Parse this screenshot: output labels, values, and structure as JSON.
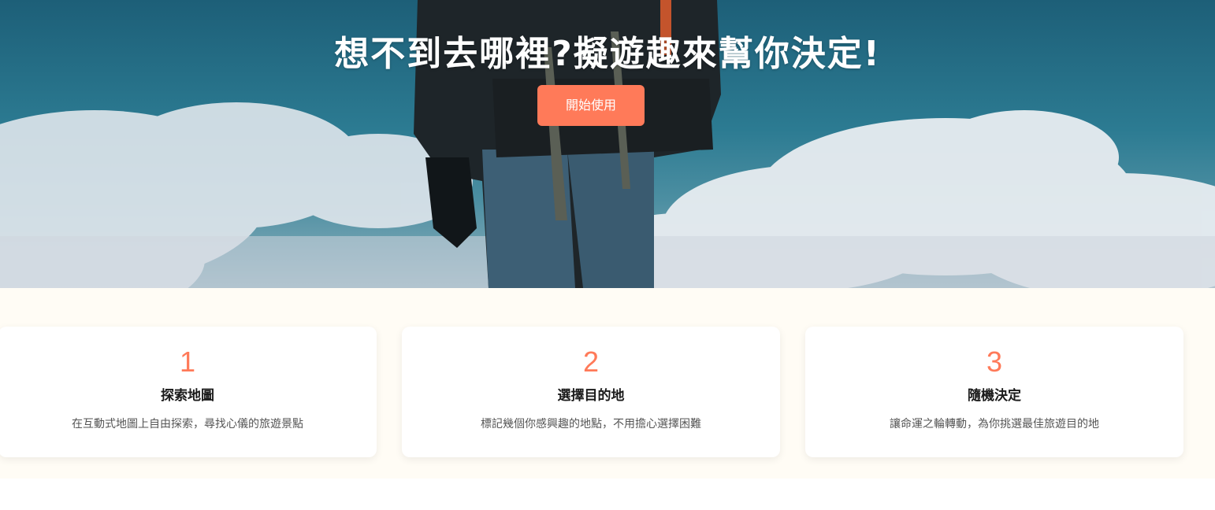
{
  "hero": {
    "title": "想不到去哪裡?擬遊趣來幫你決定!",
    "cta_label": "開始使用",
    "accent_color": "#ff7a59"
  },
  "steps": [
    {
      "number": "1",
      "title": "探索地圖",
      "description": "在互動式地圖上自由探索，尋找心儀的旅遊景點"
    },
    {
      "number": "2",
      "title": "選擇目的地",
      "description": "標記幾個你感興趣的地點，不用擔心選擇困難"
    },
    {
      "number": "3",
      "title": "隨機決定",
      "description": "讓命運之輪轉動，為你挑選最佳旅遊目的地"
    }
  ]
}
